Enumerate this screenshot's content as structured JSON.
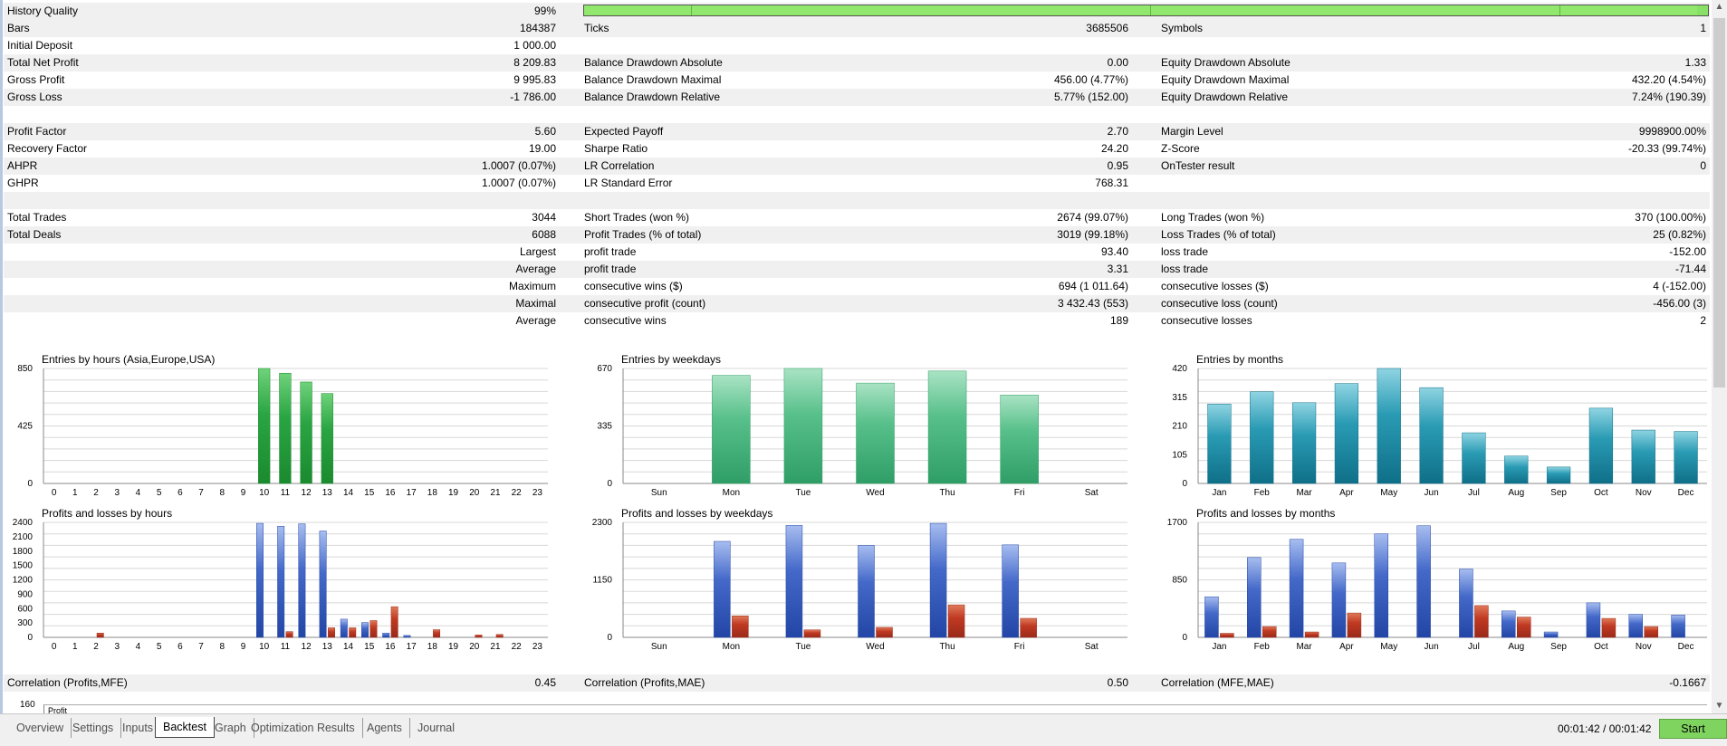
{
  "quality": {
    "label": "History Quality",
    "value": "99%"
  },
  "rows": [
    {
      "shade": true,
      "l1": "Bars",
      "v1": "184387",
      "l2": "Ticks",
      "v2": "3685506",
      "l3": "Symbols",
      "v3": "1"
    },
    {
      "shade": false,
      "l1": "Initial Deposit",
      "v1": "1 000.00",
      "l2": "",
      "v2": "",
      "l3": "",
      "v3": ""
    },
    {
      "shade": true,
      "l1": "Total Net Profit",
      "v1": "8 209.83",
      "l2": "Balance Drawdown Absolute",
      "v2": "0.00",
      "l3": "Equity Drawdown Absolute",
      "v3": "1.33"
    },
    {
      "shade": false,
      "l1": "Gross Profit",
      "v1": "9 995.83",
      "l2": "Balance Drawdown Maximal",
      "v2": "456.00 (4.77%)",
      "l3": "Equity Drawdown Maximal",
      "v3": "432.20 (4.54%)"
    },
    {
      "shade": true,
      "l1": "Gross Loss",
      "v1": "-1 786.00",
      "l2": "Balance Drawdown Relative",
      "v2": "5.77% (152.00)",
      "l3": "Equity Drawdown Relative",
      "v3": "7.24% (190.39)"
    },
    {
      "shade": false,
      "l1": "",
      "v1": "",
      "l2": "",
      "v2": "",
      "l3": "",
      "v3": ""
    },
    {
      "shade": true,
      "l1": "Profit Factor",
      "v1": "5.60",
      "l2": "Expected Payoff",
      "v2": "2.70",
      "l3": "Margin Level",
      "v3": "9998900.00%"
    },
    {
      "shade": false,
      "l1": "Recovery Factor",
      "v1": "19.00",
      "l2": "Sharpe Ratio",
      "v2": "24.20",
      "l3": "Z-Score",
      "v3": "-20.33 (99.74%)"
    },
    {
      "shade": true,
      "l1": "AHPR",
      "v1": "1.0007 (0.07%)",
      "l2": "LR Correlation",
      "v2": "0.95",
      "l3": "OnTester result",
      "v3": "0"
    },
    {
      "shade": false,
      "l1": "GHPR",
      "v1": "1.0007 (0.07%)",
      "l2": "LR Standard Error",
      "v2": "768.31",
      "l3": "",
      "v3": ""
    },
    {
      "shade": true,
      "l1": "",
      "v1": "",
      "l2": "",
      "v2": "",
      "l3": "",
      "v3": ""
    },
    {
      "shade": false,
      "l1": "Total Trades",
      "v1": "3044",
      "l2": "Short Trades (won %)",
      "v2": "2674 (99.07%)",
      "l3": "Long Trades (won %)",
      "v3": "370 (100.00%)"
    },
    {
      "shade": true,
      "l1": "Total Deals",
      "v1": "6088",
      "l2": "Profit Trades (% of total)",
      "v2": "3019 (99.18%)",
      "l3": "Loss Trades (% of total)",
      "v3": "25 (0.82%)"
    },
    {
      "shade": false,
      "l1": "",
      "v1": "Largest",
      "l2": "profit trade",
      "v2": "93.40",
      "l3": "loss trade",
      "v3": "-152.00"
    },
    {
      "shade": true,
      "l1": "",
      "v1": "Average",
      "l2": "profit trade",
      "v2": "3.31",
      "l3": "loss trade",
      "v3": "-71.44"
    },
    {
      "shade": false,
      "l1": "",
      "v1": "Maximum",
      "l2": "consecutive wins ($)",
      "v2": "694 (1 011.64)",
      "l3": "consecutive losses ($)",
      "v3": "4 (-152.00)"
    },
    {
      "shade": true,
      "l1": "",
      "v1": "Maximal",
      "l2": "consecutive profit (count)",
      "v2": "3 432.43 (553)",
      "l3": "consecutive loss (count)",
      "v3": "-456.00 (3)"
    },
    {
      "shade": false,
      "l1": "",
      "v1": "Average",
      "l2": "consecutive wins",
      "v2": "189",
      "l3": "consecutive losses",
      "v3": "2"
    }
  ],
  "correlation": {
    "l1": "Correlation (Profits,MFE)",
    "v1": "0.45",
    "l2": "Correlation (Profits,MAE)",
    "v2": "0.50",
    "l3": "Correlation (MFE,MAE)",
    "v3": "-0.1667"
  },
  "bottom_chart": {
    "ytick": "160",
    "label": "Profit"
  },
  "chart_data": [
    {
      "id": "entries-hours",
      "type": "bar",
      "title": "Entries by hours (Asia,Europe,USA)",
      "categories": [
        "0",
        "1",
        "2",
        "3",
        "4",
        "5",
        "6",
        "7",
        "8",
        "9",
        "10",
        "11",
        "12",
        "13",
        "14",
        "15",
        "16",
        "17",
        "18",
        "19",
        "20",
        "21",
        "22",
        "23"
      ],
      "yticks": [
        "850",
        "425",
        "0"
      ],
      "ylim": [
        0,
        850
      ],
      "series": [
        {
          "color": "green",
          "values": [
            0,
            0,
            0,
            0,
            0,
            0,
            0,
            0,
            0,
            0,
            850,
            815,
            750,
            665,
            0,
            0,
            0,
            0,
            0,
            0,
            0,
            0,
            0,
            0
          ]
        }
      ]
    },
    {
      "id": "entries-weekdays",
      "type": "bar",
      "title": "Entries by weekdays",
      "categories": [
        "Sun",
        "Mon",
        "Tue",
        "Wed",
        "Thu",
        "Fri",
        "Sat"
      ],
      "yticks": [
        "670",
        "335",
        "0"
      ],
      "ylim": [
        0,
        670
      ],
      "series": [
        {
          "color": "mint",
          "values": [
            0,
            630,
            670,
            585,
            655,
            515,
            0
          ]
        }
      ]
    },
    {
      "id": "entries-months",
      "type": "bar",
      "title": "Entries by months",
      "categories": [
        "Jan",
        "Feb",
        "Mar",
        "Apr",
        "May",
        "Jun",
        "Jul",
        "Aug",
        "Sep",
        "Oct",
        "Nov",
        "Dec"
      ],
      "yticks": [
        "420",
        "315",
        "210",
        "105",
        "0"
      ],
      "ylim": [
        0,
        420
      ],
      "series": [
        {
          "color": "teal",
          "values": [
            290,
            335,
            295,
            365,
            420,
            350,
            185,
            100,
            60,
            275,
            195,
            190
          ]
        }
      ]
    },
    {
      "id": "pl-hours",
      "type": "bar",
      "title": "Profits and losses by hours",
      "categories": [
        "0",
        "1",
        "2",
        "3",
        "4",
        "5",
        "6",
        "7",
        "8",
        "9",
        "10",
        "11",
        "12",
        "13",
        "14",
        "15",
        "16",
        "17",
        "18",
        "19",
        "20",
        "21",
        "22",
        "23"
      ],
      "yticks": [
        "2400",
        "2100",
        "1800",
        "1500",
        "1200",
        "900",
        "600",
        "300",
        "0"
      ],
      "ylim": [
        0,
        2400
      ],
      "series": [
        {
          "name": "profit",
          "color": "blue",
          "values": [
            0,
            0,
            0,
            0,
            0,
            0,
            0,
            0,
            0,
            0,
            2380,
            2320,
            2370,
            2220,
            380,
            310,
            90,
            40,
            0,
            0,
            0,
            0,
            0,
            0
          ]
        },
        {
          "name": "loss",
          "color": "red",
          "values": [
            0,
            0,
            90,
            0,
            0,
            0,
            0,
            0,
            0,
            0,
            0,
            120,
            0,
            200,
            200,
            350,
            640,
            0,
            160,
            0,
            50,
            60,
            0,
            0
          ]
        }
      ]
    },
    {
      "id": "pl-weekdays",
      "type": "bar",
      "title": "Profits and losses by weekdays",
      "categories": [
        "Sun",
        "Mon",
        "Tue",
        "Wed",
        "Thu",
        "Fri",
        "Sat"
      ],
      "yticks": [
        "2300",
        "1150",
        "0"
      ],
      "ylim": [
        0,
        2300
      ],
      "series": [
        {
          "name": "profit",
          "color": "blue",
          "values": [
            0,
            1920,
            2240,
            1840,
            2280,
            1850,
            0
          ]
        },
        {
          "name": "loss",
          "color": "red",
          "values": [
            0,
            430,
            150,
            200,
            650,
            380,
            0
          ]
        }
      ]
    },
    {
      "id": "pl-months",
      "type": "bar",
      "title": "Profits and losses by months",
      "categories": [
        "Jan",
        "Feb",
        "Mar",
        "Apr",
        "May",
        "Jun",
        "Jul",
        "Aug",
        "Sep",
        "Oct",
        "Nov",
        "Dec"
      ],
      "yticks": [
        "1700",
        "850",
        "0"
      ],
      "ylim": [
        0,
        1700
      ],
      "series": [
        {
          "name": "profit",
          "color": "blue",
          "values": [
            600,
            1180,
            1450,
            1100,
            1530,
            1650,
            1010,
            390,
            80,
            510,
            340,
            330
          ]
        },
        {
          "name": "loss",
          "color": "red",
          "values": [
            60,
            160,
            80,
            360,
            0,
            0,
            470,
            300,
            0,
            280,
            160,
            0
          ]
        }
      ]
    }
  ],
  "tabs": [
    "Overview",
    "Settings",
    "Inputs",
    "Backtest",
    "Graph",
    "Optimization Results",
    "Agents",
    "Journal"
  ],
  "active_tab": "Backtest",
  "timer": "00:01:42 / 00:01:42",
  "start_label": "Start",
  "colors": {
    "accent_green": "#7fd35f",
    "row_shade": "#f0f0f0"
  }
}
